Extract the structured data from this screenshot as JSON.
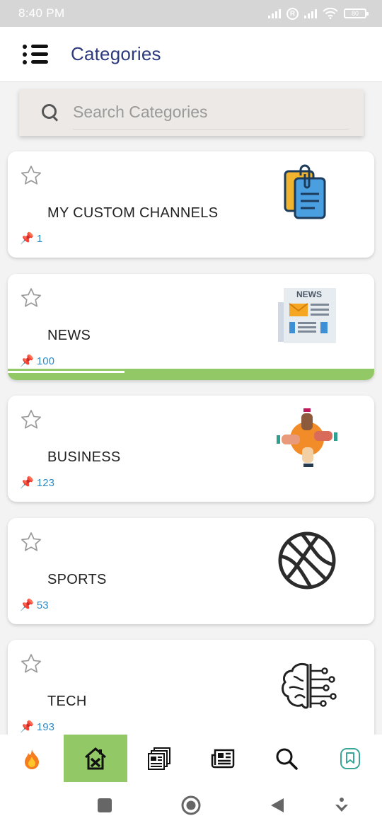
{
  "status_bar": {
    "time": "8:40 PM",
    "battery": "80"
  },
  "app_bar": {
    "title": "Categories"
  },
  "search": {
    "placeholder": "Search Categories"
  },
  "categories": [
    {
      "name": "MY CUSTOM CHANNELS",
      "count": "1",
      "icon": "clipboard-icon"
    },
    {
      "name": "NEWS",
      "count": "100",
      "icon": "newspaper-icon",
      "progress": 0.32
    },
    {
      "name": "BUSINESS",
      "count": "123",
      "icon": "teamwork-hands-icon"
    },
    {
      "name": "SPORTS",
      "count": "53",
      "icon": "basketball-icon"
    },
    {
      "name": "TECH",
      "count": "193",
      "icon": "brain-circuit-icon"
    }
  ],
  "bottom_nav": [
    {
      "icon": "fire-icon",
      "active": false
    },
    {
      "icon": "house-tools-icon",
      "active": true
    },
    {
      "icon": "documents-icon",
      "active": false
    },
    {
      "icon": "newspaper-icon",
      "active": false
    },
    {
      "icon": "search-icon",
      "active": false
    },
    {
      "icon": "bookmark-icon",
      "active": false
    }
  ],
  "colors": {
    "accent": "#92c866",
    "title": "#2e3a7e",
    "count": "#2f8bc7"
  }
}
